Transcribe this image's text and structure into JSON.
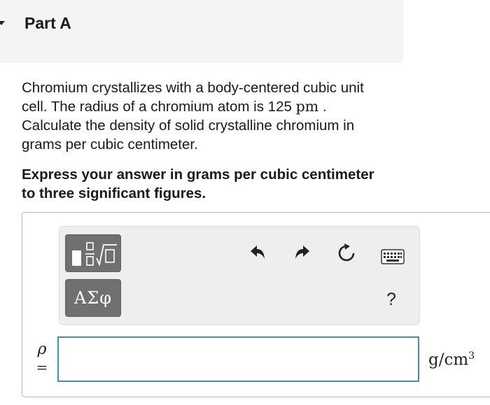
{
  "part": {
    "title": "Part A"
  },
  "question": {
    "line1": "Chromium crystallizes with a body-centered cubic unit",
    "line2_prefix": "cell. The radius of a chromium atom is 125",
    "line2_unit": "pm",
    "line2_suffix": ".",
    "line3": "Calculate the density of solid crystalline chromium in",
    "line4": "grams per cubic centimeter."
  },
  "instruction": {
    "line1": "Express your answer in grams per cubic centimeter",
    "line2": "to three significant figures."
  },
  "toolbar": {
    "templates_icon": "templates-radical-icon",
    "symbols_label": "ΑΣφ",
    "undo_icon": "undo-icon",
    "redo_icon": "redo-icon",
    "reset_icon": "reset-icon",
    "keyboard_icon": "keyboard-icon",
    "help_label": "?"
  },
  "answer": {
    "variable": "ρ",
    "equals": "=",
    "value": "",
    "unit_base": "g/cm",
    "unit_exp": "3"
  }
}
